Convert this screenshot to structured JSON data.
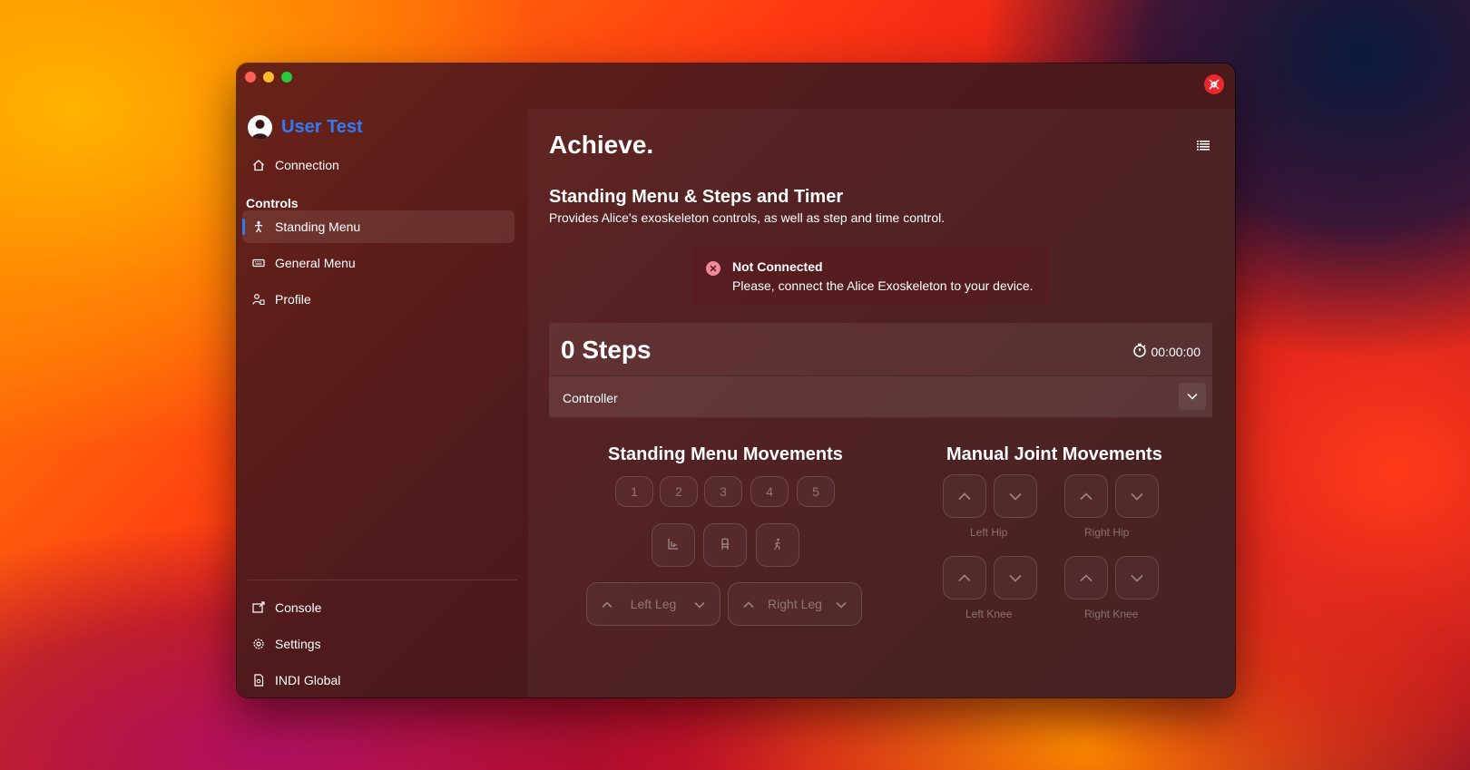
{
  "sidebar": {
    "user_name": "User Test",
    "connection": "Connection",
    "controls_label": "Controls",
    "items": [
      {
        "label": "Standing Menu"
      },
      {
        "label": "General Menu"
      },
      {
        "label": "Profile"
      }
    ],
    "bottom": [
      {
        "label": "Console"
      },
      {
        "label": "Settings"
      },
      {
        "label": "INDI Global"
      }
    ]
  },
  "main": {
    "title": "Achieve.",
    "section_title": "Standing Menu & Steps and Timer",
    "section_subtitle": "Provides Alice's exoskeleton controls, as well as step and time control.",
    "alert": {
      "title": "Not Connected",
      "message": "Please, connect the Alice Exoskeleton to your device."
    },
    "steps": "0 Steps",
    "timer": "00:00:00",
    "controller_label": "Controller",
    "standing_title": "Standing Menu Movements",
    "numbers": [
      "1",
      "2",
      "3",
      "4",
      "5"
    ],
    "left_leg": "Left Leg",
    "right_leg": "Right Leg",
    "manual_title": "Manual Joint Movements",
    "joints": {
      "left_hip": "Left Hip",
      "right_hip": "Right Hip",
      "left_knee": "Left Knee",
      "right_knee": "Right Knee"
    }
  },
  "colors": {
    "accent": "#2f7bf6",
    "error": "#f08a98"
  }
}
